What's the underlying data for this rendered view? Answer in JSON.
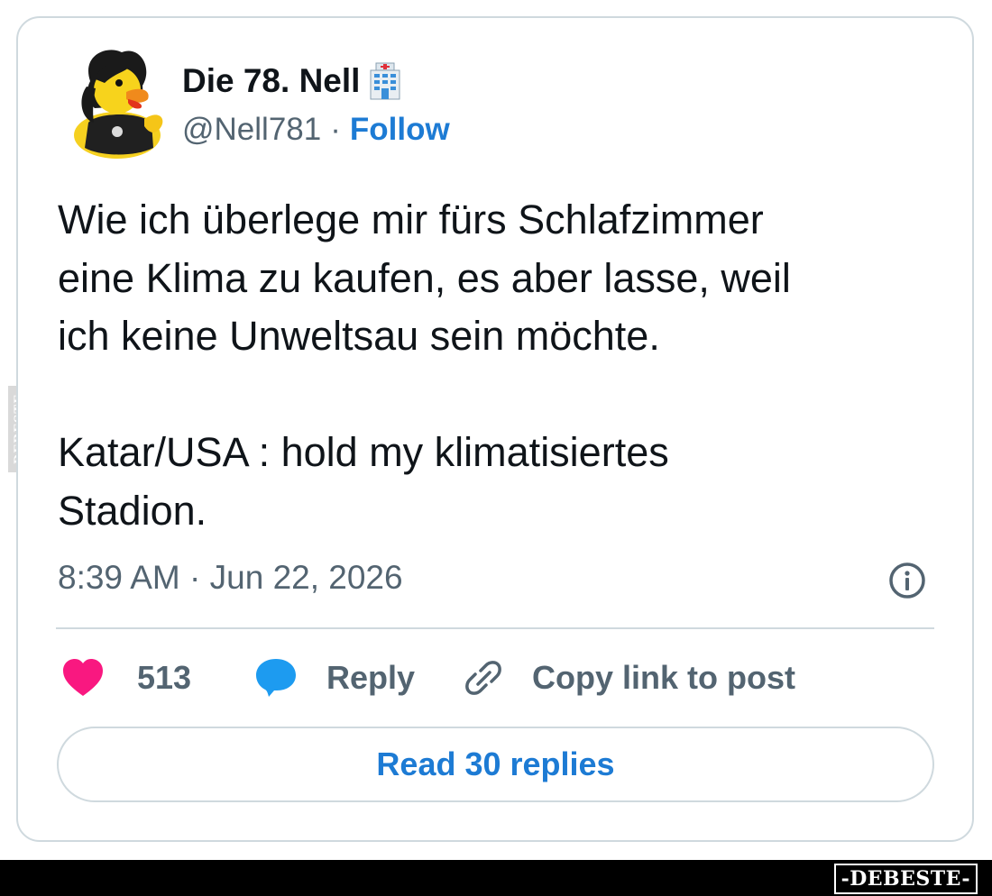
{
  "author": {
    "display_name": "Die 78. Nell",
    "name_emoji_icon": "hospital-icon",
    "handle": "@Nell781",
    "separator": "·",
    "follow_label": "Follow",
    "avatar_icon": "rubber-duck-avatar"
  },
  "tweet": {
    "text": "Wie ich überlege mir fürs Schlafzimmer\neine Klima zu kaufen, es aber lasse, weil\nich keine Unweltsau sein möchte.\n\nKatar/USA : hold my klimatisiertes\nStadion.",
    "timestamp": "8:39 AM · Jun 22, 2026"
  },
  "actions": {
    "like_count": "513",
    "reply_label": "Reply",
    "copy_label": "Copy link to post"
  },
  "read_replies_label": "Read 30 replies",
  "watermark": {
    "side_text": "DEBESTE",
    "brand_text": "-DEBESTE-"
  },
  "colors": {
    "accent_blue": "#1d9bf0",
    "link_blue": "#1d7bd4",
    "heart_pink": "#f91880",
    "muted_text": "#536471",
    "border": "#cfd9de"
  }
}
